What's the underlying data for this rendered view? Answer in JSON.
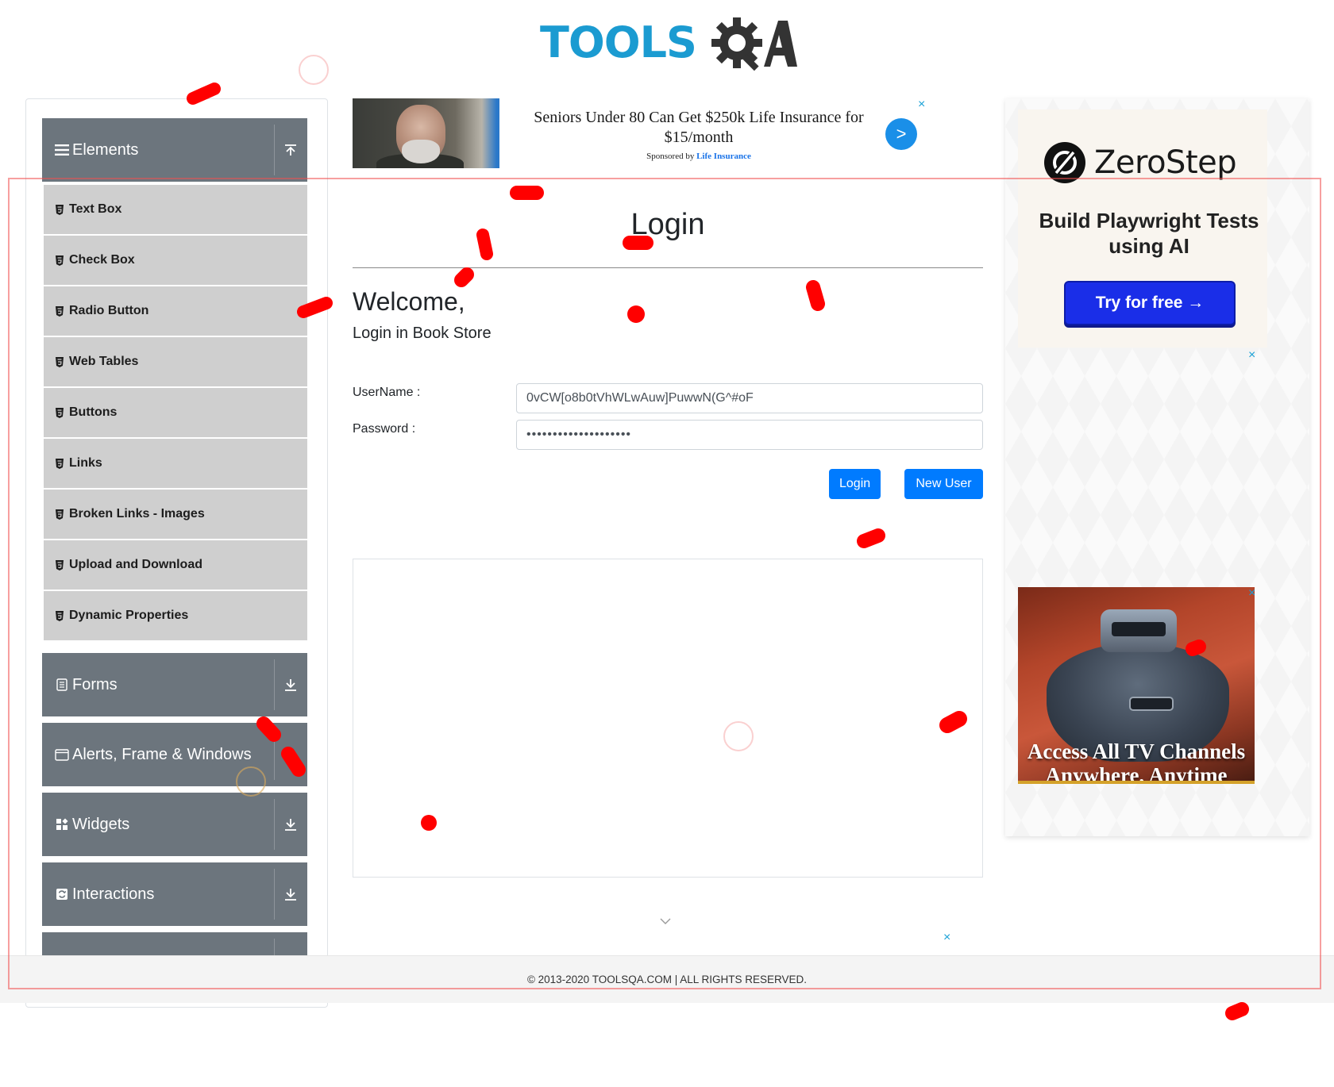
{
  "header": {
    "logo_text": "TOOLS",
    "logo_suffix": "QA"
  },
  "sidebar": {
    "groups": [
      {
        "label": "Elements",
        "icon": "hamburger-icon",
        "state": "expanded",
        "items": [
          "Text Box",
          "Check Box",
          "Radio Button",
          "Web Tables",
          "Buttons",
          "Links",
          "Broken Links - Images",
          "Upload and Download",
          "Dynamic Properties"
        ]
      },
      {
        "label": "Forms",
        "icon": "document-icon",
        "state": "collapsed"
      },
      {
        "label": "Alerts, Frame & Windows",
        "icon": "window-icon",
        "state": "collapsed"
      },
      {
        "label": "Widgets",
        "icon": "widgets-icon",
        "state": "collapsed"
      },
      {
        "label": "Interactions",
        "icon": "interactions-icon",
        "state": "collapsed"
      }
    ]
  },
  "banner_ad": {
    "headline": "Seniors Under 80 Can Get $250k Life Insurance for $15/month",
    "sponsor_prefix": "Sponsored by",
    "sponsor_name": "Life Insurance",
    "go_label": ">",
    "close_label": "×"
  },
  "main": {
    "title": "Login",
    "welcome": "Welcome,",
    "welcome_sub": "Login in Book Store",
    "username_label": "UserName :",
    "username_value": "0vCW[o8b0tVhWLwAuw]PuwwN(G^#oF",
    "password_label": "Password :",
    "password_value": "••••••••••••••••••••",
    "login_button": "Login",
    "new_user_button": "New User",
    "bottom_ad_close": "×"
  },
  "right_ad": {
    "brand": "ZeroStep",
    "tagline": "Build Playwright Tests using AI",
    "cta": "Try for free →",
    "close_label": "×",
    "tv_headline": "Access All TV Channels Anywhere, Anytime",
    "tv_close_label": "×"
  },
  "footer": {
    "text": "© 2013-2020 TOOLSQA.COM | ALL RIGHTS RESERVED."
  },
  "colors": {
    "accent": "#007bff",
    "sidebar_header": "#6c757d",
    "sidebar_item": "#cfcfcf",
    "logo_blue": "#1b9bd1",
    "annotation": "#ff0000"
  }
}
